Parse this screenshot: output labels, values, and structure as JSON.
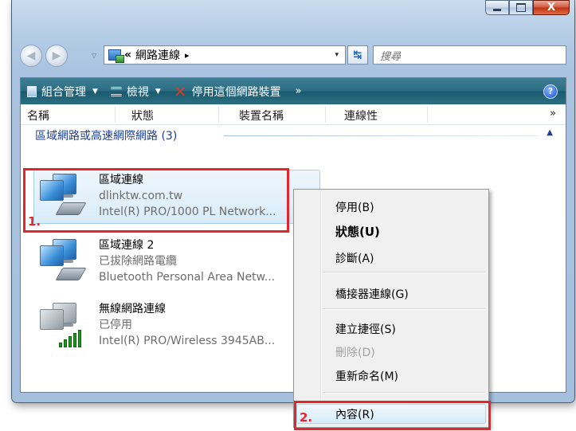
{
  "window": {
    "caption_buttons": [
      "minimize",
      "maximize",
      "close"
    ],
    "close_glyph": "X"
  },
  "nav": {
    "breadcrumb_prefix": "«",
    "breadcrumb": "網路連線",
    "breadcrumb_arrow": "▸",
    "dropdown_arrow": "▾",
    "search_placeholder": "搜尋"
  },
  "toolbar": {
    "organize": "組合管理",
    "view": "檢視",
    "disable": "停用這個網路裝置",
    "more": "»",
    "help": "?"
  },
  "columns": [
    "名稱",
    "狀態",
    "裝置名稱",
    "連線性"
  ],
  "columns_more": "»",
  "group": {
    "title": "區域網路或高速網際網路 (3)",
    "caret": "▲"
  },
  "connections": [
    {
      "name": "區域連線",
      "status": "dlinktw.com.tw",
      "device": "Intel(R) PRO/1000 PL Network..."
    },
    {
      "name": "區域連線 2",
      "status": "已拔除網路電纜",
      "device": "Bluetooth Personal Area Netw..."
    },
    {
      "name": "無線網路連線",
      "status": "已停用",
      "device": "Intel(R) PRO/Wireless 3945AB..."
    }
  ],
  "context_menu": {
    "disable": "停用(B)",
    "status": "狀態(U)",
    "diagnose": "診斷(A)",
    "bridge": "橋接器連線(G)",
    "shortcut": "建立捷徑(S)",
    "delete": "刪除(D)",
    "rename": "重新命名(M)",
    "properties": "內容(R)"
  },
  "annotations": {
    "step1": "1.",
    "step2": "2."
  },
  "colors": {
    "highlight": "#e3262e",
    "toolbar": "#2d6d83",
    "group_text": "#1e3f93"
  }
}
